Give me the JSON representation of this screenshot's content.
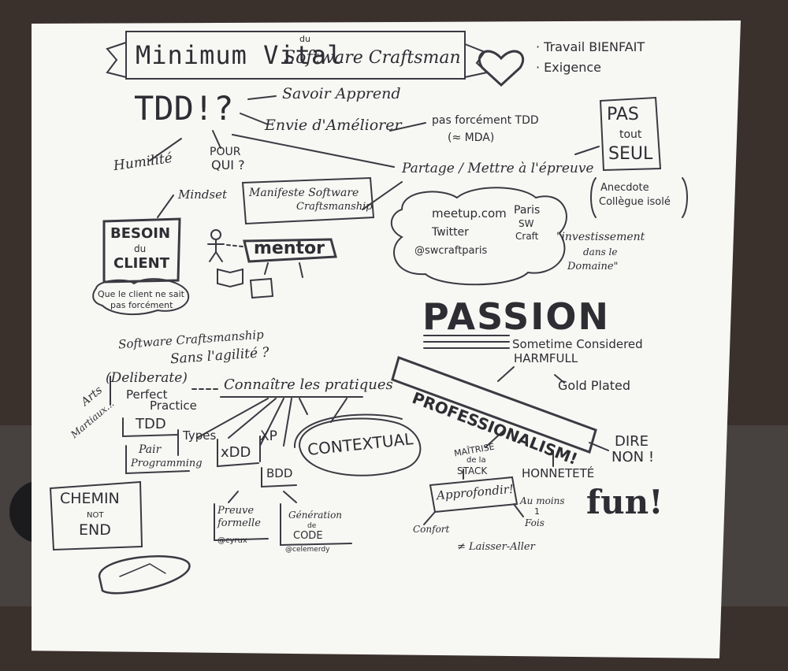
{
  "board": {
    "title_main": "Minimum Vital",
    "title_du": "du",
    "title_sub": "Software Craftsman",
    "heart_items": [
      "· Travail BIENFAIT",
      "· Exigence"
    ],
    "tdd": "TDD!?",
    "savoir": "Savoir Apprend",
    "envie": "Envie d'Améliorer",
    "pas_force": "pas forcément TDD",
    "mda": "(≈ MDA)",
    "pas_tout_seul": [
      "PAS",
      "tout",
      "SEUL"
    ],
    "humilite": "Humilité",
    "pour_qui": [
      "POUR",
      "QUI ?"
    ],
    "partage": "Partage / Mettre à l'épreuve",
    "anecdote": [
      "Anecdote",
      "Collègue isolé"
    ],
    "mindset": "Mindset",
    "manifeste": [
      "Manifeste Software",
      "Craftsmanship"
    ],
    "meetup": "meetup.com",
    "paris": [
      "Paris",
      "SW",
      "Craft"
    ],
    "twitter": "Twitter",
    "handle": "@swcraftparis",
    "investissement": [
      "\"investissement",
      "dans le",
      "Domaine\""
    ],
    "besoin": [
      "BESOIN",
      "du",
      "CLIENT"
    ],
    "client_sait": [
      "Que le client ne sait",
      "pas forcément"
    ],
    "mentor": "mentor",
    "passion": "PASSION",
    "sometime": "Sometime Considered",
    "harmfull": "HARMFULL",
    "sc_agilite": [
      "Software Craftsmanship",
      "Sans l'agilité ?"
    ],
    "professionalism": "PROFESSIONALISM!",
    "gold_plated": "Gold Plated",
    "deliberate": "(Deliberate)",
    "perfect": [
      "Perfect",
      "Practice"
    ],
    "connaitre": "Connaître les pratiques",
    "arts_martiaux": [
      "Arts",
      "Martiaux..."
    ],
    "tdd2": "TDD",
    "types": "Types",
    "xp": "XP",
    "contextual": "CONTEXTUAL",
    "pair": [
      "Pair",
      "Programming"
    ],
    "xdd": "xDD",
    "bdd": "BDD",
    "maitrise": [
      "MAÎTRISE",
      "de la",
      "STACK"
    ],
    "honnetete": "HONNETETÉ",
    "dire_non": [
      "DIRE",
      "NON !"
    ],
    "chemin": [
      "CHEMIN",
      "NOT",
      "END"
    ],
    "preuve": [
      "Preuve",
      "formelle"
    ],
    "cyrux": "@cyrux",
    "generation": [
      "Génération",
      "de",
      "CODE"
    ],
    "celement": "@celemerdy",
    "approfondir": "Approfondir!",
    "au_moins": [
      "Au moins",
      "1",
      "Fois"
    ],
    "fun": "fun!",
    "confort": "Confort",
    "laisser": "≠ Laisser-Aller"
  }
}
